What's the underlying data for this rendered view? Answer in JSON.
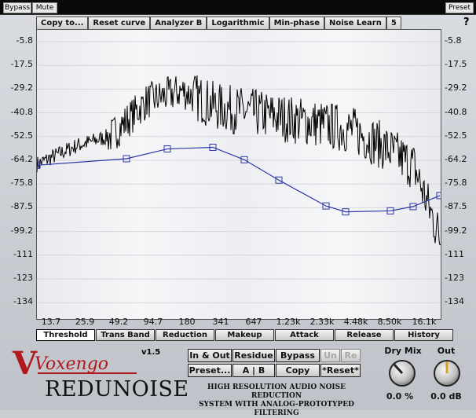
{
  "topbar": {
    "bypass": "Bypass",
    "mute": "Mute",
    "preset": "Preset"
  },
  "toolbar": [
    "Copy to...",
    "Reset curve",
    "Analyzer B",
    "Logarithmic",
    "Min-phase",
    "Noise Learn",
    "5"
  ],
  "help": "?",
  "y_ticks": [
    "-5.8",
    "-17.5",
    "-29.2",
    "-40.8",
    "-52.5",
    "-64.2",
    "-75.8",
    "-87.5",
    "-99.2",
    "-111",
    "-123",
    "-134"
  ],
  "x_ticks": [
    "13.7",
    "25.9",
    "49.2",
    "94.7",
    "180",
    "341",
    "647",
    "1.23k",
    "2.33k",
    "4.48k",
    "8.50k",
    "16.1k"
  ],
  "tabs": [
    "Threshold",
    "Trans Band",
    "Reduction",
    "Makeup",
    "Attack",
    "Release",
    "History"
  ],
  "active_tab": "Threshold",
  "version": "v1.5",
  "product": {
    "brand": "Voxengo",
    "name": "REDUNOISE"
  },
  "buttons": {
    "in_out": "In & Out",
    "residue": "Residue",
    "bypass": "Bypass",
    "undo": "Un",
    "redo": "Re",
    "preset": "Preset...",
    "ab": "A | B",
    "copy": "Copy",
    "reset": "*Reset*"
  },
  "description": [
    "HIGH RESOLUTION AUDIO NOISE REDUCTION",
    "SYSTEM WITH ANALOG-PROTOTYPED FILTERING"
  ],
  "dry_mix": {
    "label": "Dry Mix",
    "value": "0.0 %"
  },
  "out": {
    "label": "Out",
    "value": "0.0 dB"
  },
  "threshold_curve_db": [
    -66.5,
    -63.3,
    -58.5,
    -57.7,
    -63.8,
    -73.8,
    -86.5,
    -89.4,
    -88.9,
    -86.8,
    -81.4
  ],
  "colors": {
    "curve": "#2b35a8",
    "spectrum": "#000000",
    "topbar": "#0a0a0a",
    "logo_red": "#b0181a"
  }
}
